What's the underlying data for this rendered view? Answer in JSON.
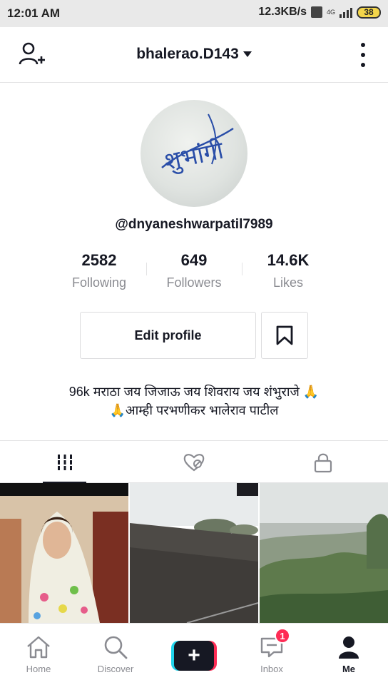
{
  "status_bar": {
    "time": "12:01 AM",
    "speed": "12.3KB/s",
    "network": "4G",
    "battery": "38"
  },
  "header": {
    "title": "bhalerao.D143"
  },
  "profile": {
    "avatar_text": "शुभांगी",
    "username": "@dnyaneshwarpatil7989",
    "stats": [
      {
        "value": "2582",
        "label": "Following"
      },
      {
        "value": "649",
        "label": "Followers"
      },
      {
        "value": "14.6K",
        "label": "Likes"
      }
    ],
    "edit_profile_label": "Edit profile",
    "bio_line1": "96k मराठा जय जिजाऊ जय शिवराय जय शंभुराजे 🙏",
    "bio_line2": "🙏आम्ही परभणीकर भालेराव पाटील"
  },
  "tabs": [
    "videos-grid",
    "liked-videos",
    "private-videos"
  ],
  "bottom_nav": {
    "home": "Home",
    "discover": "Discover",
    "inbox": "Inbox",
    "inbox_badge": "1",
    "me": "Me"
  },
  "colors": {
    "text_primary": "#161823",
    "text_secondary": "#8a8b91",
    "accent_red": "#fe2c55",
    "accent_cyan": "#20d5ec"
  }
}
